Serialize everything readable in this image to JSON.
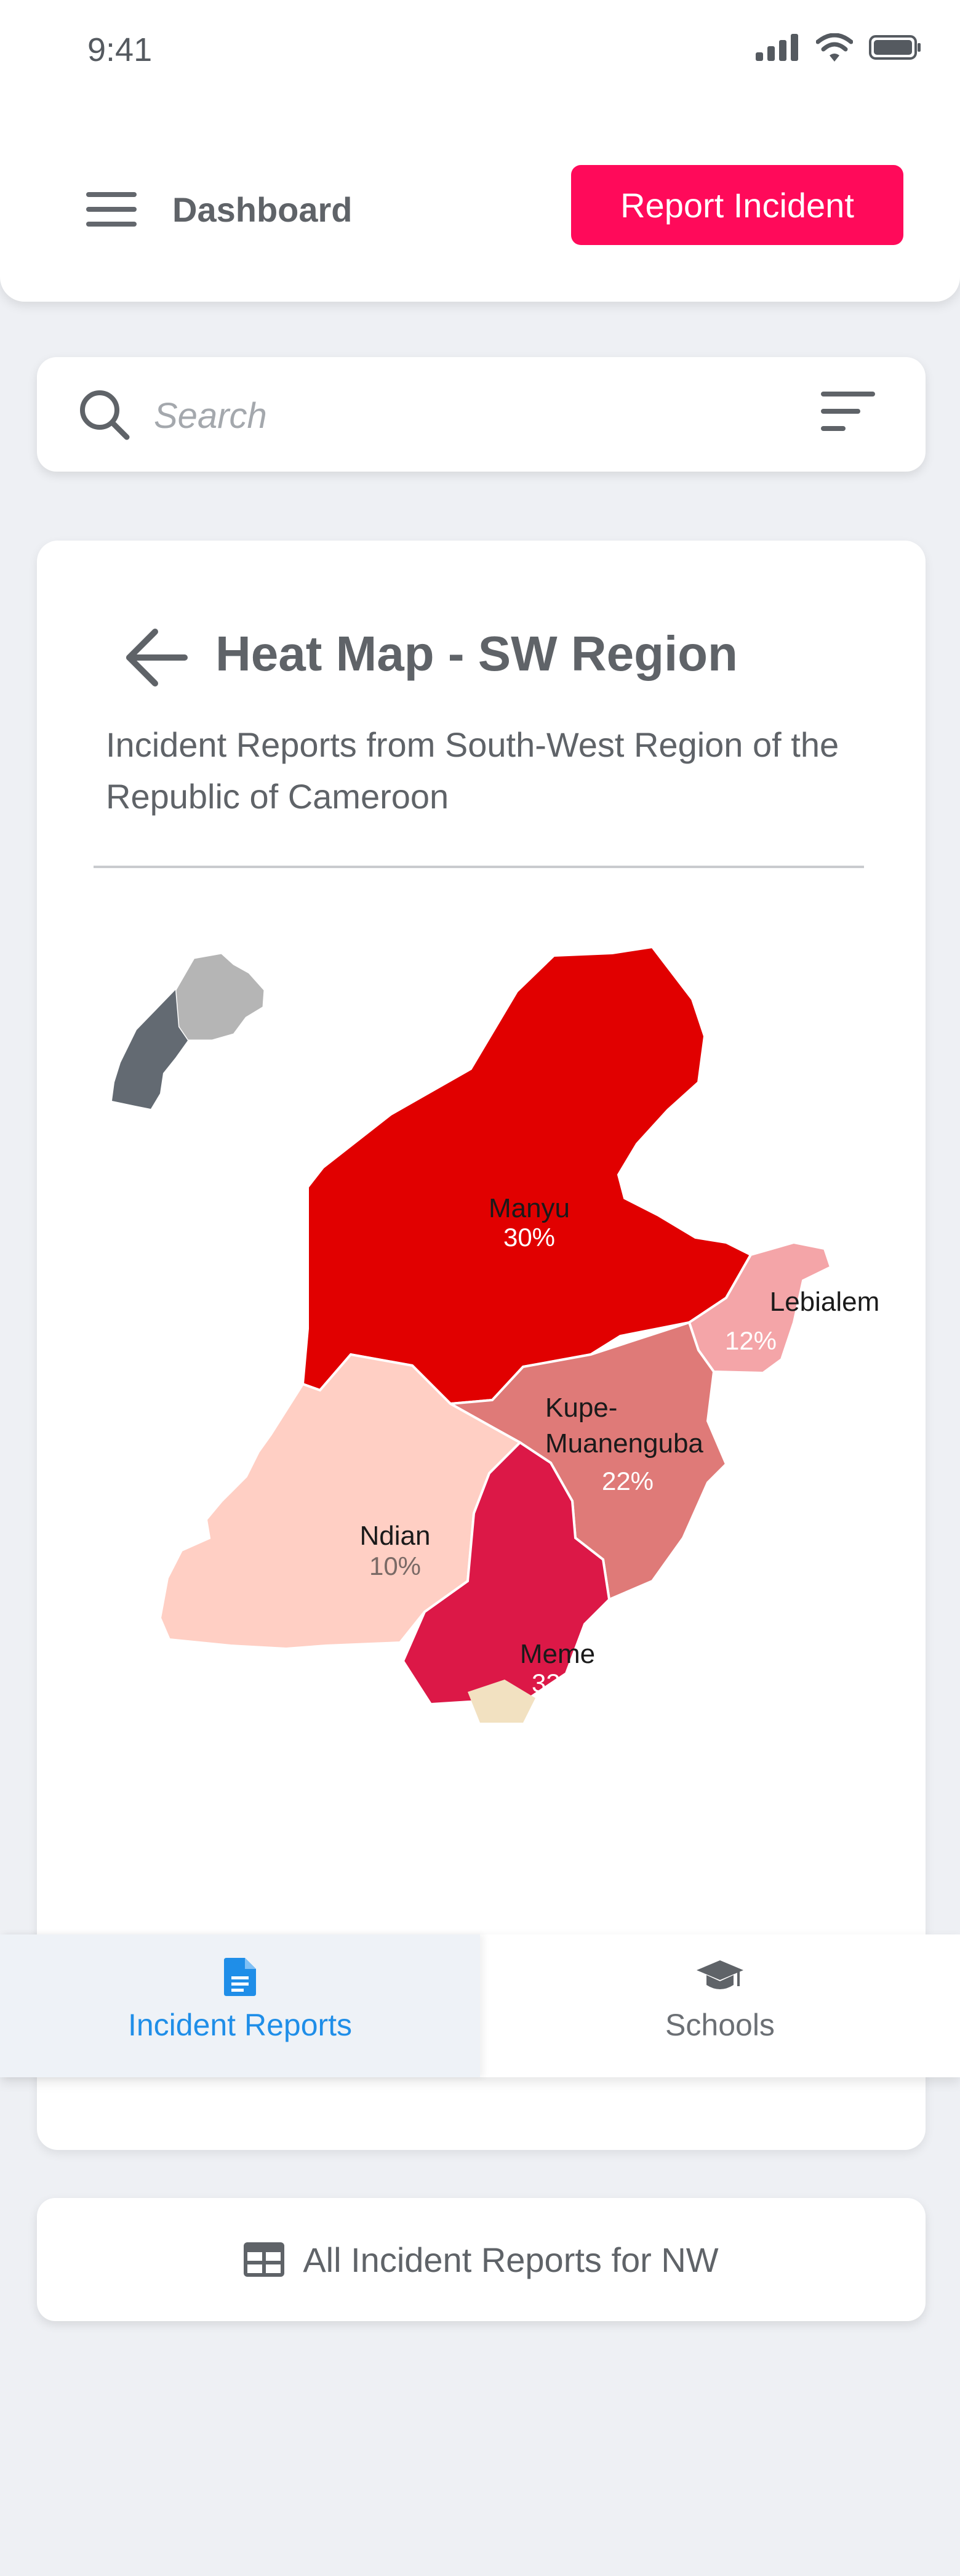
{
  "status_bar": {
    "time": "9:41"
  },
  "header": {
    "title": "Dashboard",
    "report_button": "Report Incident"
  },
  "search": {
    "placeholder": "Search"
  },
  "card": {
    "title": "Heat Map - SW Region",
    "subtitle": "Incident Reports from South-West Region of the Republic of Cameroon"
  },
  "map": {
    "regions": [
      {
        "name": "Manyu",
        "percent": "30%",
        "color": "#e10000"
      },
      {
        "name": "Lebialem",
        "percent": "12%",
        "color": "#f4a5a8"
      },
      {
        "name": "Kupe-",
        "name2": "Muanenguba",
        "percent": "22%",
        "color": "#df7a78"
      },
      {
        "name": "Ndian",
        "percent": "10%",
        "color": "#ffcfc4"
      },
      {
        "name": "Meme",
        "percent": "33%",
        "color": "#dc1847"
      }
    ],
    "inset_colors": {
      "dark": "#636a72",
      "light": "#b5b5b5"
    }
  },
  "bottom_nav": {
    "items": [
      {
        "label": "Incident Reports",
        "icon": "document-icon",
        "active": true
      },
      {
        "label": "Schools",
        "icon": "graduation-cap-icon",
        "active": false
      }
    ]
  },
  "all_reports_button": {
    "label": "All Incident Reports for NW",
    "icon": "table-icon"
  },
  "colors": {
    "accent": "#ff0a5a",
    "active_nav": "#1f8ee8",
    "background": "#eef0f4"
  }
}
